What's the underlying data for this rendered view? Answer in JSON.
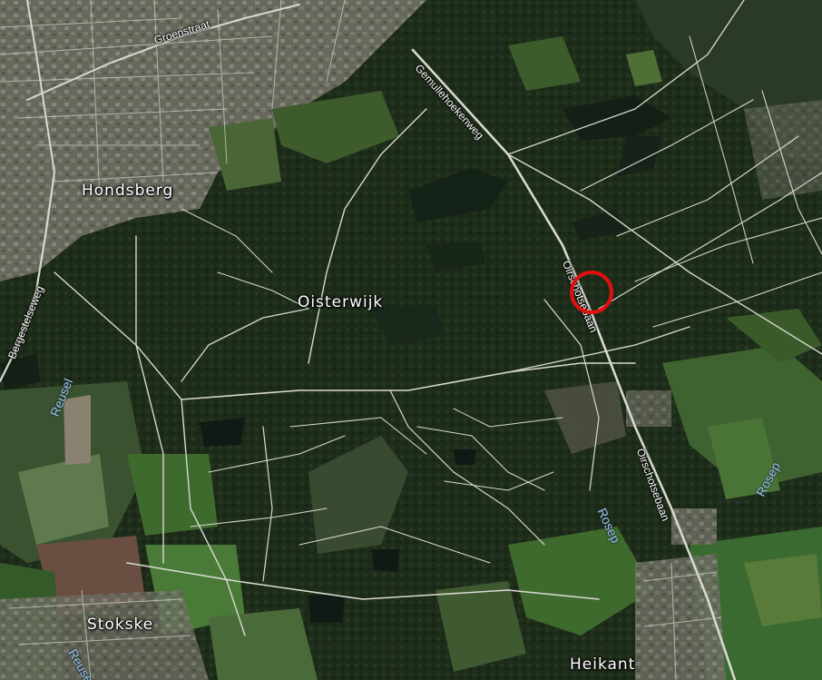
{
  "map": {
    "style": "satellite",
    "colors": {
      "forest": "#1f2e1b",
      "field": "#3c5a2a",
      "urban": "#6d6e62",
      "road": "#d8d8d0",
      "water_label": "#9cc0ff",
      "marker": "#e01010"
    },
    "labels": {
      "hondsberg": "Hondsberg",
      "oisterwijk": "Oisterwijk",
      "stokske": "Stokske",
      "heikant": "Heikant",
      "groenstraat": "Groenstraat",
      "gemullehoekenweg": "Gemullehoekenweg",
      "oirschotsebaan_upper": "Oirschotsebaan",
      "oirschotsebaan_lower": "Oirschotsebaan",
      "bergestelseweg": "Bergestelseweg",
      "reusel_upper": "Reusel",
      "reusel_lower": "Reusel",
      "rosep_center": "Rosep",
      "rosep_right": "Rosep"
    },
    "marker": {
      "shape": "circle",
      "color": "#e01010"
    }
  }
}
